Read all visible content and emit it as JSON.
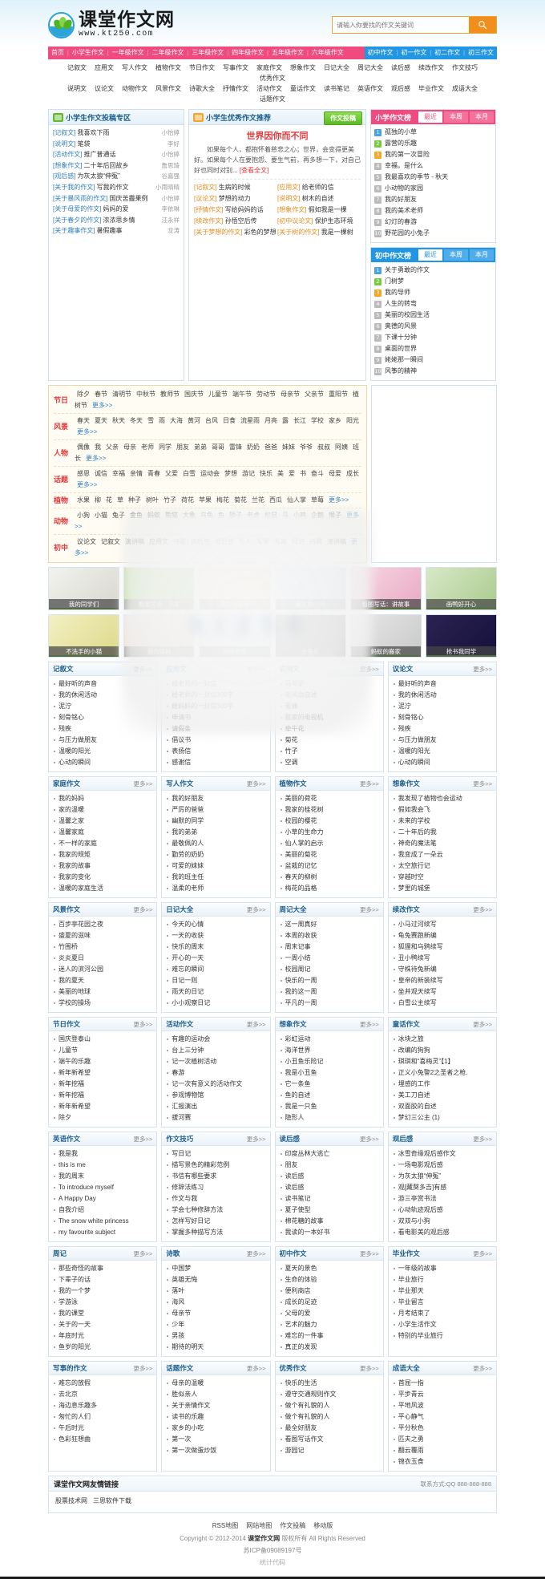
{
  "site": {
    "logo_title": "课堂作文网",
    "logo_url": "www.kt250.com"
  },
  "search": {
    "placeholder": "请输入你要找的作文关键词",
    "icon": "search-icon"
  },
  "nav_main_pink": [
    "首页",
    "小学生作文",
    "一年级作文",
    "二年级作文",
    "三年级作文",
    "四年级作文",
    "五年级作文",
    "六年级作文"
  ],
  "nav_main_blue": [
    "初中作文",
    "初一作文",
    "初二作文",
    "初三作文"
  ],
  "nav_sub_row1": [
    "记叙文",
    "应用文",
    "写人作文",
    "植物作文",
    "节日作文",
    "写事作文",
    "家庭作文",
    "想象作文",
    "日记大全",
    "周记大全",
    "读后感",
    "续改作文",
    "作文技巧",
    "优秀作文"
  ],
  "nav_sub_row2": [
    "说明文",
    "议论文",
    "动物作文",
    "风景作文",
    "诗歌大全",
    "抒情作文",
    "活动作文",
    "童话作文",
    "读书笔记",
    "英语作文",
    "观后感",
    "毕业作文",
    "成语大全",
    "话题作文"
  ],
  "submit_panel": {
    "title": "小学生作文投稿专区",
    "icon": "upload-badge-icon",
    "items": [
      {
        "cat": "[记叙文]",
        "title": "我喜欢下雨",
        "author": "小怡婷"
      },
      {
        "cat": "[说明文]",
        "title": "笔袋",
        "author": "李好"
      },
      {
        "cat": "[活动作文]",
        "title": "推广普通话",
        "author": "小怡婷"
      },
      {
        "cat": "[想象作文]",
        "title": "二十年后回故乡",
        "author": "詹思琦"
      },
      {
        "cat": "[观后感]",
        "title": "为灰太狼“伸冤”",
        "author": "谷嘉强"
      },
      {
        "cat": "[关于我的作文]",
        "title": "写我的作文",
        "author": "小雨晴晴"
      },
      {
        "cat": "[关于暴风雨的作文]",
        "title": "国庆苦霾果例",
        "author": "小怡婷"
      },
      {
        "cat": "[关于母爱的作文]",
        "title": "妈妈的爱",
        "author": "李依琳"
      },
      {
        "cat": "[关于春夕的作文]",
        "title": "浓浓思乡情",
        "author": "汪永祥"
      },
      {
        "cat": "[关于趣事作文]",
        "title": "暑假趣事",
        "author": "龙涛"
      }
    ]
  },
  "recommend_panel": {
    "title": "小学生优秀作文推荐",
    "icon": "star-badge-icon",
    "submit_button": "作文投稿",
    "feature_title": "世界因你而不同",
    "feature_summary": "如果每个人，都抱怀着慈悲之心；世界，会变得更美好。如果每个人在要抱怨、要生气前，再多想一下，对自己好也同时对别...",
    "read_more": "[查看全文]",
    "items": [
      {
        "cat": "[记叙文]",
        "title": "生病的时候"
      },
      {
        "cat": "[应用文]",
        "title": "给老师的信"
      },
      {
        "cat": "[议论文]",
        "title": "梦想的动力"
      },
      {
        "cat": "[说明文]",
        "title": "树木的自述"
      },
      {
        "cat": "[抒情作文]",
        "title": "写给妈妈的话"
      },
      {
        "cat": "[想象作文]",
        "title": "假如我是一棵"
      },
      {
        "cat": "[续改作文]",
        "title": "孙悟空后传"
      },
      {
        "cat": "[初中议论文]",
        "title": "保护生态环境"
      },
      {
        "cat": "[关于梦想的作文]",
        "title": "彩色的梦想"
      },
      {
        "cat": "[关于树的作文]",
        "title": "我是一棵树"
      }
    ]
  },
  "rank_primary": {
    "title": "小学作文榜",
    "tabs": [
      {
        "label": "最近",
        "active": true
      },
      {
        "label": "本周",
        "active": false
      },
      {
        "label": "本月",
        "active": false
      }
    ],
    "items": [
      "孤独的小草",
      "露营的乐趣",
      "我的第一次冒险",
      "幸福，是什么",
      "我最喜欢的季节 - 秋天",
      "小动物的家园",
      "我的好朋友",
      "我的美术老师",
      "幻灯的春游",
      "野花园的小兔子"
    ]
  },
  "rank_middle": {
    "title": "初中作文榜",
    "tabs": [
      {
        "label": "最近",
        "active": true
      },
      {
        "label": "本周",
        "active": false
      },
      {
        "label": "本月",
        "active": false
      }
    ],
    "items": [
      "关于勇敢的作文",
      "门树梦",
      "我的导师",
      "人生的转弯",
      "美丽的校园生活",
      "奥德的风景",
      "下课十分钟",
      "桌面的世界",
      "姥姥那一瞬间",
      "风筝的精神"
    ]
  },
  "tag_cloud": [
    {
      "key": "节日",
      "tags": [
        "除夕",
        "春节",
        "清明节",
        "中秋节",
        "教师节",
        "国庆节",
        "儿童节",
        "端午节",
        "劳动节",
        "母亲节",
        "父亲节",
        "重阳节",
        "植树节",
        "更多>>"
      ]
    },
    {
      "key": "风景",
      "tags": [
        "春天",
        "夏天",
        "秋天",
        "冬天",
        "雪",
        "雨",
        "大海",
        "黄河",
        "台风",
        "日食",
        "流星雨",
        "月亮",
        "露",
        "长江",
        "学校",
        "家乡",
        "阳光",
        "更多>>"
      ]
    },
    {
      "key": "人物",
      "tags": [
        "偶像",
        "我",
        "父亲",
        "母亲",
        "老师",
        "同学",
        "朋友",
        "弟弟",
        "哥哥",
        "雷锋",
        "奶奶",
        "爸爸",
        "妹妹",
        "爷爷",
        "叔叔",
        "阿姨",
        "班长",
        "更多>>"
      ]
    },
    {
      "key": "话题",
      "tags": [
        "感恩",
        "诚信",
        "幸福",
        "亲情",
        "青春",
        "父爱",
        "白雪",
        "运动会",
        "梦想",
        "游记",
        "快乐",
        "美",
        "爱",
        "书",
        "奋斗",
        "母爱",
        "成长",
        "更多>>"
      ]
    },
    {
      "key": "植物",
      "tags": [
        "水果",
        "柳",
        "花",
        "草",
        "种子",
        "树叶",
        "竹子",
        "荷花",
        "苹果",
        "梅花",
        "菊花",
        "兰花",
        "西瓜",
        "仙人掌",
        "草莓",
        "更多>>"
      ]
    },
    {
      "key": "动物",
      "tags": [
        "小狗",
        "小猫",
        "兔子",
        "金鱼",
        "蚂蚁",
        "熊猫",
        "大象",
        "乌龟",
        "鱼",
        "狮子",
        "老虎",
        "松鼠",
        "马",
        "小鸡",
        "企鹅",
        "猴子",
        "更多>>"
      ]
    },
    {
      "key": "初中",
      "tags": [
        "议论文",
        "记叙文",
        "演讲稿",
        "应用文",
        "诗歌",
        "读后感",
        "观后感",
        "写人",
        "写景",
        "写事",
        "日记",
        "诗歌",
        "演讲稿",
        "更多>>"
      ]
    }
  ],
  "thumbs_row1": [
    {
      "caption": "我的同学们"
    },
    {
      "caption": "看图写话：我家"
    },
    {
      "caption": "我的小花猫"
    },
    {
      "caption": "我家的小鸟"
    },
    {
      "caption": "看图写话：讲故事"
    },
    {
      "caption": "画鸭好开心"
    }
  ],
  "thumbs_row2": [
    {
      "caption": "不洗手的小猫"
    },
    {
      "caption": "我的妹妹"
    },
    {
      "caption": "我的老爸"
    },
    {
      "caption": "金鱼乐"
    },
    {
      "caption": "蚂蚁的搬家"
    },
    {
      "caption": "抢书我同学"
    }
  ],
  "more_label": "更多>>",
  "columns": [
    {
      "title": "记叙文",
      "items": [
        "最好听的声音",
        "我的休闲活动",
        "泥泞",
        "刻骨铭心",
        "残疾",
        "与压力做朋友",
        "温暖的阳光",
        "心动的瞬间"
      ]
    },
    {
      "title": "应用文",
      "items": [
        "给老师的一封信",
        "给老师的一封信300字",
        "给妈妈的一封信300字",
        "申请书",
        "请假条",
        "倡议书",
        "表扬信",
        "感谢信"
      ]
    },
    {
      "title": "说明文",
      "items": [
        "马与驴",
        "电风扇自述",
        "蜜蜂",
        "我家的电视机",
        "牵牛花",
        "菊花",
        "竹子",
        "空调"
      ]
    },
    {
      "title": "议论文",
      "items": [
        "最好听的声音",
        "我的休闲活动",
        "泥泞",
        "刻骨铭心",
        "残疾",
        "与压力做朋友",
        "温暖的阳光",
        "心动的瞬间"
      ]
    },
    {
      "title": "家庭作文",
      "items": [
        "我的妈妈",
        "家的温暖",
        "温馨之家",
        "温馨家庭",
        "不一样的家庭",
        "我家的规矩",
        "我家的故事",
        "我家的变化",
        "温暖的家庭生活"
      ]
    },
    {
      "title": "写人作文",
      "items": [
        "我的好朋友",
        "严厉的爸爸",
        "幽默的同学",
        "我的弟弟",
        "最敬佩的人",
        "勤劳的奶奶",
        "可爱的妹妹",
        "我的班主任",
        "温柔的老师"
      ]
    },
    {
      "title": "植物作文",
      "items": [
        "美丽的荷花",
        "我家的桂花树",
        "校园的樱花",
        "小草的生命力",
        "仙人掌的启示",
        "美丽的菊花",
        "盆栽的记忆",
        "春天的柳树",
        "梅花的品格"
      ]
    },
    {
      "title": "想象作文",
      "items": [
        "我发现了植物也会运动",
        "假如我会飞",
        "未来的学校",
        "二十年后的我",
        "神奇的魔法笔",
        "我变成了一朵云",
        "太空旅行记",
        "穿越时空",
        "梦里的城堡"
      ]
    },
    {
      "title": "风景作文",
      "items": [
        "百步亭花园之夜",
        "盛夏的滋味",
        "竹围桥",
        "炎炎夏日",
        "迷人的滨河公园",
        "我的夏天",
        "美丽的地球",
        "学校的操场"
      ]
    },
    {
      "title": "日记大全",
      "items": [
        "今天的心情",
        "一天的收获",
        "快乐的周末",
        "开心的一天",
        "难忘的瞬间",
        "日记一则",
        "雨天的日记",
        "小小观察日记"
      ]
    },
    {
      "title": "周记大全",
      "items": [
        "这一周真好",
        "本周的收获",
        "周末记事",
        "一周小结",
        "校园周记",
        "快乐的一周",
        "我的这一周",
        "平凡的一周"
      ]
    },
    {
      "title": "续改作文",
      "items": [
        "小马过河续写",
        "龟兔赛跑新编",
        "狐狸和乌鸦续写",
        "丑小鸭续写",
        "守株待兔新编",
        "皇帝的新装续写",
        "坐井观天续写",
        "白雪公主续写"
      ]
    },
    {
      "title": "节日作文",
      "items": [
        "国庆登泰山",
        "儿童节",
        "端午的乐趣",
        "新年新希望",
        "新年挖福",
        "新年挖福",
        "新年新希望",
        "除夕"
      ]
    },
    {
      "title": "活动作文",
      "items": [
        "有趣的运动会",
        "台上三分钟",
        "记一次植树活动",
        "春游",
        "记一次有意义的活动作文",
        "参观博物馆",
        "汇报演出",
        "拔河赛"
      ]
    },
    {
      "title": "想象作文",
      "items": [
        "彩虹运动",
        "海洋世界",
        "小丑鱼乐险记",
        "我是小丑鱼",
        "它一条鱼",
        "鱼的自述",
        "我是一只鱼",
        "隐形人"
      ]
    },
    {
      "title": "童话作文",
      "items": [
        "冰块之旅",
        "改编的狗狗",
        "琪琪和“喜梅灵”【1】",
        "正义小兔警2之圣者之枪.",
        "埋感的工作",
        "美工刀自述",
        "双面胶的自述",
        "梦幻三公主 (1)"
      ]
    },
    {
      "title": "英语作文",
      "items": [
        "我是我",
        "this is me",
        "我的周末",
        "To introduce myself",
        "A Happy Day",
        "自我介绍",
        "The snow white princess",
        "my favourite subject"
      ]
    },
    {
      "title": "作文技巧",
      "items": [
        "写日记",
        "描写景色的精彩范例",
        "书信有哪些要求",
        "修辞法练习",
        "作文与我",
        "学会七种修辞方法",
        "怎样写好日记",
        "掌握多种描写方法"
      ]
    },
    {
      "title": "读后感",
      "items": [
        "印度丛林大逃亡",
        "朋友",
        "读后感",
        "读后感",
        "读书笔记",
        "夏子使型",
        "棉花糖的故事",
        "我读的一本好书"
      ]
    },
    {
      "title": "观后感",
      "items": [
        "冰雪奇缘观后感作文",
        "一场电影观后感",
        "为灰太狼“伸冤”",
        "观[藏獒多吉]有感",
        "游三亭赏书法",
        "心动轨迹观后感",
        "双双与小狗",
        "看电影美的观后感"
      ]
    },
    {
      "title": "周记",
      "items": [
        "那些奇怪的故事",
        "下辈子的话",
        "我的一个梦",
        "学游泳",
        "我的课堂",
        "关于的一天",
        "年底时光",
        "鱼岁的阳光"
      ]
    },
    {
      "title": "诗歌",
      "items": [
        "中国梦",
        "英雄无悔",
        "落叶",
        "海风",
        "母亲节",
        "少年",
        "男孩",
        "期待的明天"
      ]
    },
    {
      "title": "初中作文",
      "items": [
        "夏天的景色",
        "生命的体验",
        "便利商店",
        "成长的足迹",
        "父母的爱",
        "艺术的魅力",
        "难忘的一件事",
        "真正的发现"
      ]
    },
    {
      "title": "毕业作文",
      "items": [
        "一年级的故事",
        "毕业旅行",
        "毕业那天",
        "毕业留言",
        "月考结束了",
        "小学生活作文",
        "特别的毕业旅行"
      ]
    },
    {
      "title": "写事的作文",
      "items": [
        "难忘的放假",
        "去北京",
        "海边息乐趣多",
        "匆忙的人们",
        "午后时光",
        "色彩狂想曲"
      ]
    },
    {
      "title": "话题作文",
      "items": [
        "母亲的温暖",
        "胜似亲人",
        "关于亲情作文",
        "读书的乐趣",
        "家乡的小吃",
        "第一次",
        "第一次做蛋炒饭"
      ]
    },
    {
      "title": "优秀作文",
      "items": [
        "快乐的生活",
        "遵守交通规则作文",
        "做个有礼貌的人",
        "做个有礼貌的人",
        "最全好朋友",
        "看图写话作文",
        "游园记"
      ]
    },
    {
      "title": "成语大全",
      "items": [
        "首屈一指",
        "平步青云",
        "平地风波",
        "平心静气",
        "平分秋色",
        "匹夫之勇",
        "翻云覆雨",
        "锦衣玉食"
      ]
    }
  ],
  "friend_links": {
    "title": "课堂作文网友情链接",
    "contact": "联系方式:QQ 888-888-888",
    "links": [
      "股票技术网",
      "三思软件下载"
    ]
  },
  "footer": {
    "links": [
      "RSS地图",
      "网站地图",
      "作文投稿",
      "移动版"
    ],
    "copyright_pre": "Copyright © 2012-2014",
    "copyright_site": "课堂作文网",
    "copyright_post": "版权所有 All Rights Reserved",
    "icp": "苏ICP备09089197号",
    "stats": "统计代码"
  }
}
